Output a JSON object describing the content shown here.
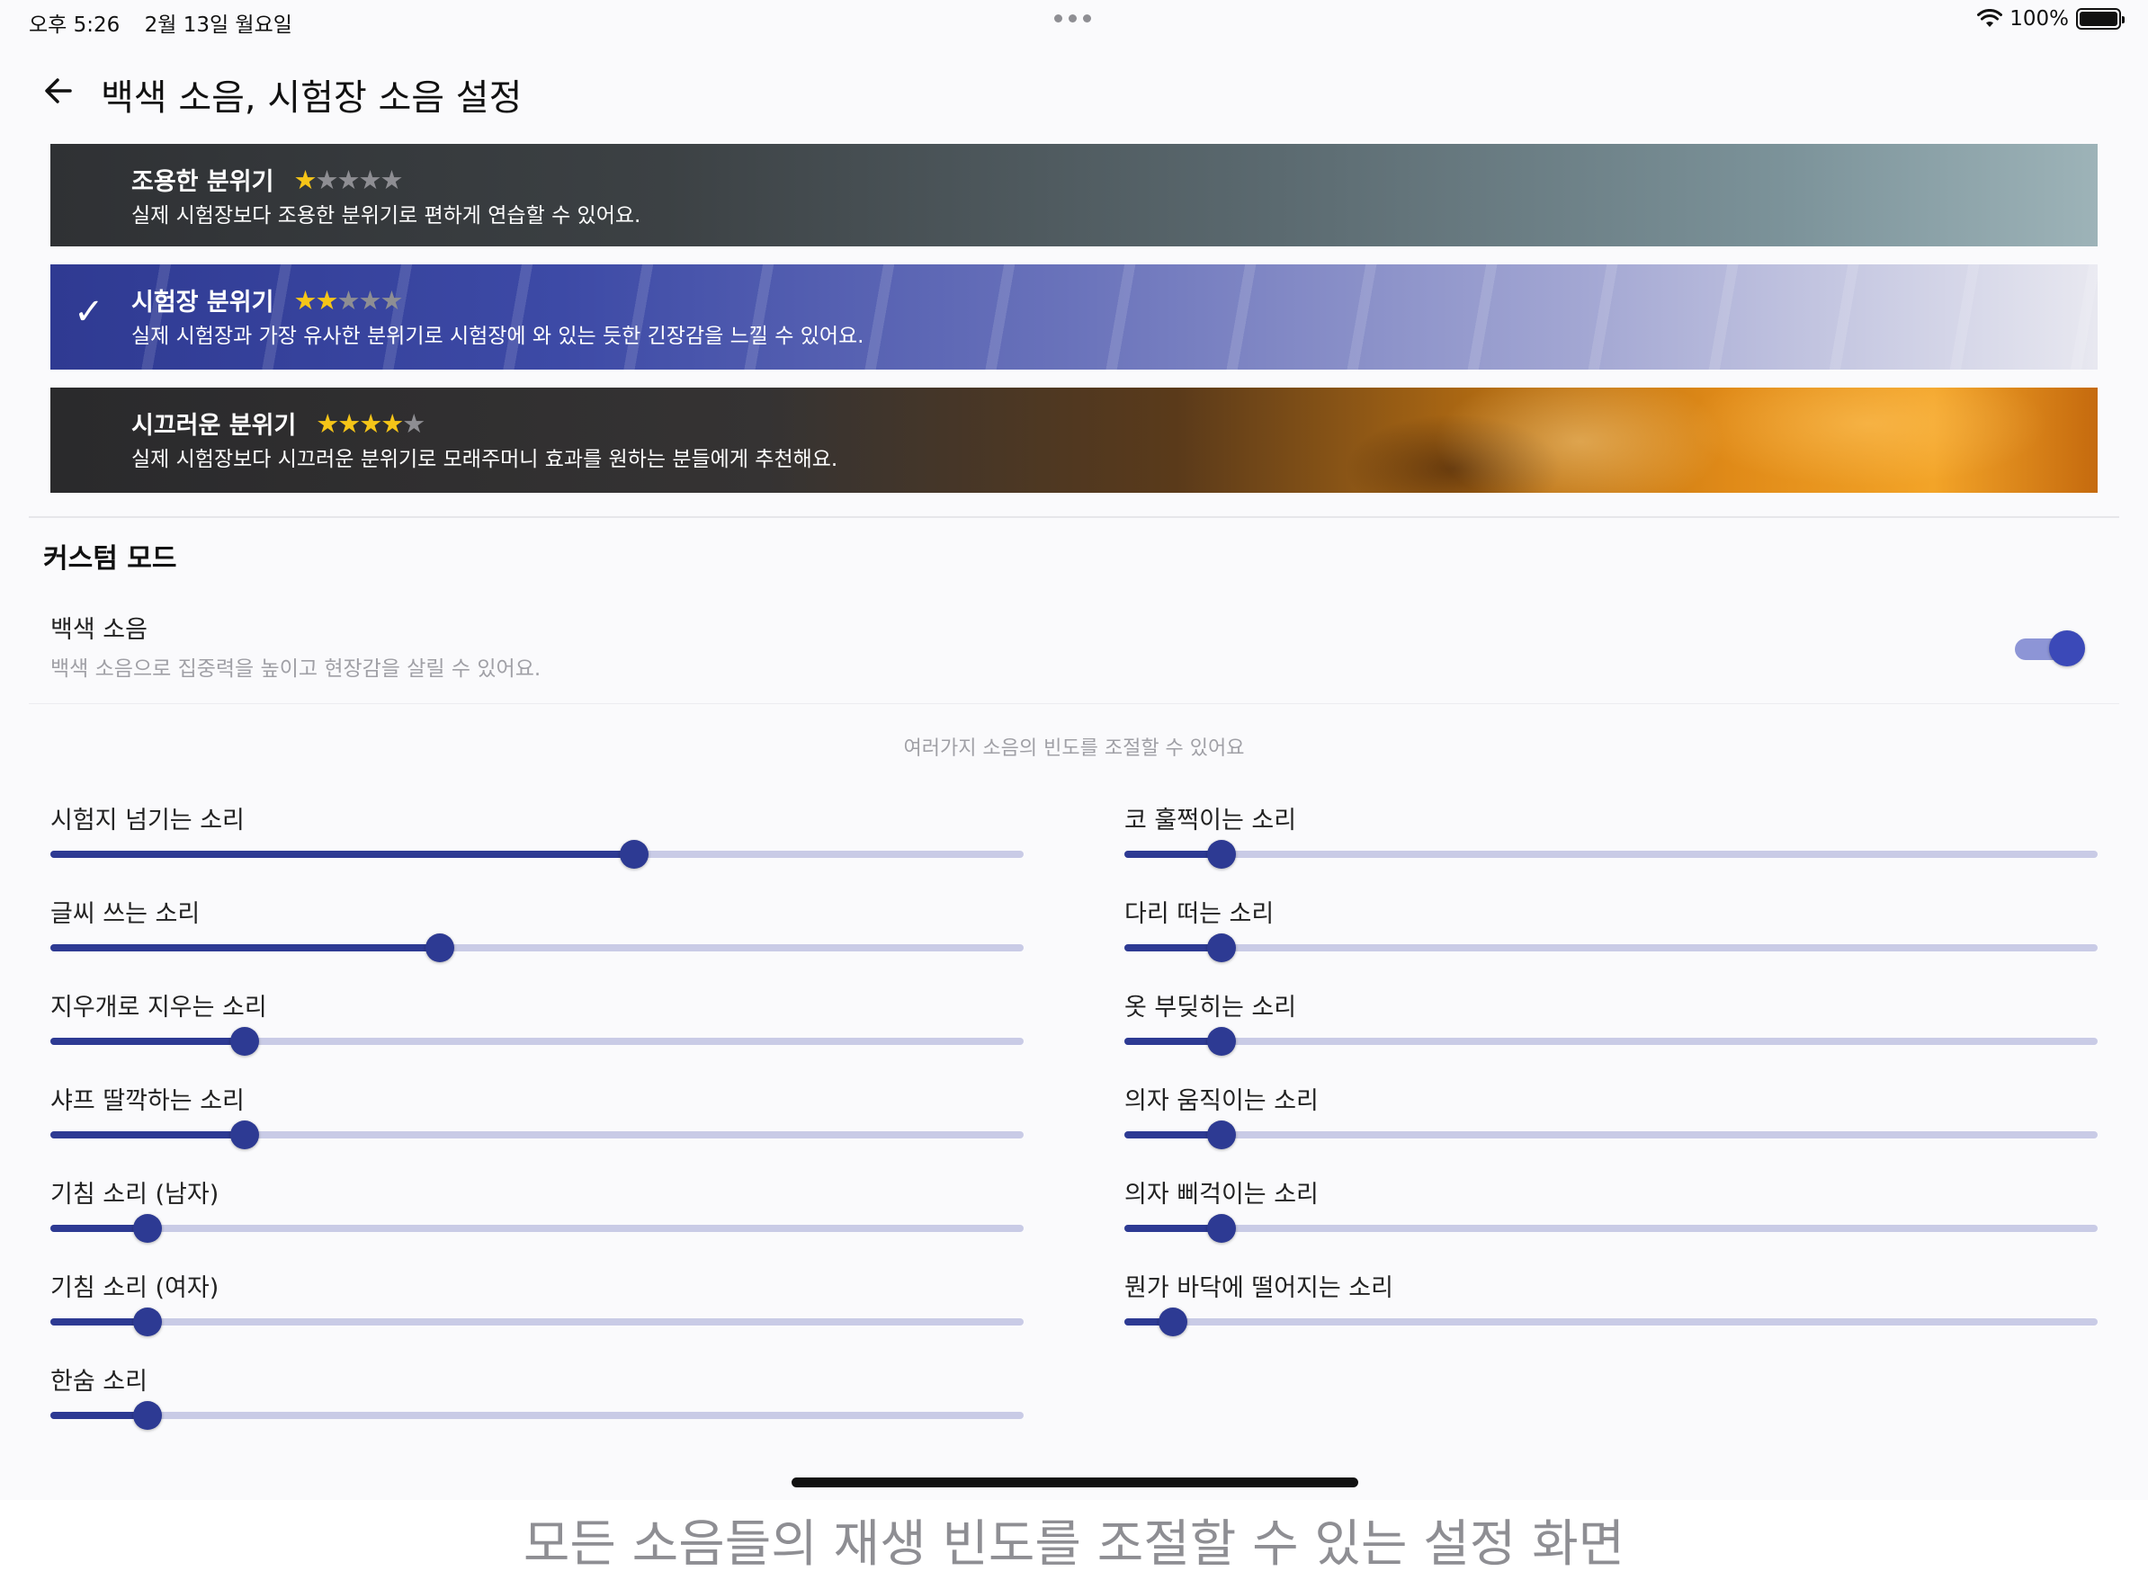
{
  "status_bar": {
    "time": "오후 5:26",
    "date": "2월 13일 월요일",
    "battery": "100%"
  },
  "header": {
    "title": "백색 소음, 시험장 소음 설정"
  },
  "modes": [
    {
      "title": "조용한 분위기",
      "rating": 1,
      "max_rating": 5,
      "description": "실제 시험장보다 조용한 분위기로 편하게 연습할 수 있어요.",
      "selected": false
    },
    {
      "title": "시험장 분위기",
      "rating": 2,
      "max_rating": 5,
      "description": "실제 시험장과 가장 유사한 분위기로 시험장에 와 있는 듯한 긴장감을 느낄 수 있어요.",
      "selected": true
    },
    {
      "title": "시끄러운 분위기",
      "rating": 4,
      "max_rating": 5,
      "description": "실제 시험장보다 시끄러운 분위기로 모래주머니 효과를 원하는 분들에게 추천해요.",
      "selected": false
    }
  ],
  "custom": {
    "title": "커스텀 모드",
    "white_noise": {
      "label": "백색 소음",
      "description": "백색 소음으로 집중력을 높이고 현장감을 살릴 수 있어요.",
      "enabled": true
    },
    "hint": "여러가지 소음의 빈도를 조절할 수 있어요"
  },
  "sliders_left": [
    {
      "label": "시험지 넘기는 소리",
      "value": 0.6
    },
    {
      "label": "글씨 쓰는 소리",
      "value": 0.4
    },
    {
      "label": "지우개로 지우는 소리",
      "value": 0.2
    },
    {
      "label": "샤프 딸깍하는 소리",
      "value": 0.2
    },
    {
      "label": "기침 소리 (남자)",
      "value": 0.1
    },
    {
      "label": "기침 소리 (여자)",
      "value": 0.1
    },
    {
      "label": "한숨 소리",
      "value": 0.1
    }
  ],
  "sliders_right": [
    {
      "label": "코 훌쩍이는 소리",
      "value": 0.1
    },
    {
      "label": "다리 떠는 소리",
      "value": 0.1
    },
    {
      "label": "옷 부딪히는 소리",
      "value": 0.1
    },
    {
      "label": "의자 움직이는 소리",
      "value": 0.1
    },
    {
      "label": "의자 삐걱이는 소리",
      "value": 0.1
    },
    {
      "label": "뭔가 바닥에 떨어지는 소리",
      "value": 0.05
    }
  ],
  "caption": "모든 소음들의 재생 빈도를 조절할 수 있는 설정 화면",
  "colors": {
    "accent": "#2d3a93",
    "track": "#c9cbe6",
    "star_on": "#f5c518"
  },
  "icons": {
    "back": "arrow-left-icon",
    "check": "checkmark-icon",
    "wifi": "wifi-icon",
    "battery": "battery-icon"
  }
}
